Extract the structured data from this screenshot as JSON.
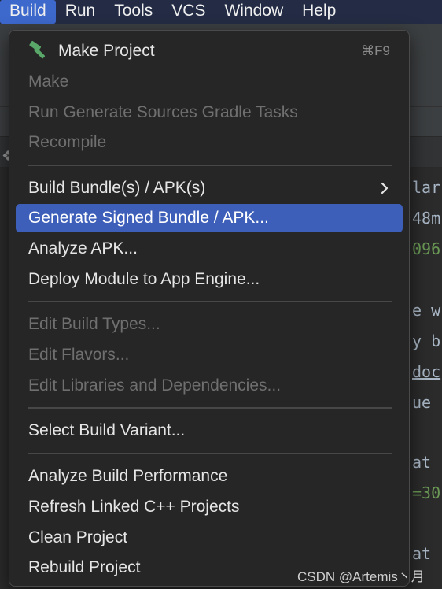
{
  "menubar": {
    "items": [
      {
        "label": "Build",
        "active": true
      },
      {
        "label": "Run"
      },
      {
        "label": "Tools"
      },
      {
        "label": "VCS"
      },
      {
        "label": "Window"
      },
      {
        "label": "Help"
      }
    ]
  },
  "build_menu": {
    "make_project": {
      "label": "Make Project",
      "shortcut": "⌘F9",
      "icon": "hammer-icon"
    },
    "make": "Make",
    "run_generate_sources": "Run Generate Sources Gradle Tasks",
    "recompile": "Recompile",
    "build_bundles": "Build Bundle(s) / APK(s)",
    "generate_signed": "Generate Signed Bundle / APK...",
    "analyze_apk": "Analyze APK...",
    "deploy_module": "Deploy Module to App Engine...",
    "edit_build_types": "Edit Build Types...",
    "edit_flavors": "Edit Flavors...",
    "edit_libraries": "Edit Libraries and Dependencies...",
    "select_build_variant": "Select Build Variant...",
    "analyze_build_performance": "Analyze Build Performance",
    "refresh_linked_cpp": "Refresh Linked C++ Projects",
    "clean_project": "Clean Project",
    "rebuild_project": "Rebuild Project"
  },
  "editor": {
    "code_fragments": [
      "lar",
      "48m",
      "096",
      "e w",
      "y b",
      "doc",
      "ue",
      "at",
      "=30",
      "at"
    ],
    "colors": {
      "default": "#a9b7c6",
      "number": "#6a9955",
      "link": "#a9b7c6"
    }
  },
  "watermark": "CSDN @Artemis丶月"
}
